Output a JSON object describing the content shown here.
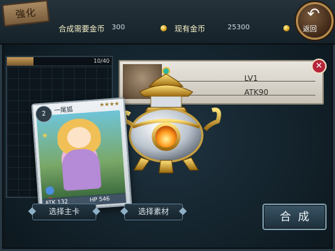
{
  "header": {
    "title": "強化",
    "cost_label": "合成需要金币",
    "cost_value": "300",
    "gold_label": "现有金币",
    "gold_value": "25300",
    "back_label": "返回"
  },
  "left_panel": {
    "progress_text": "10/40",
    "progress_fraction": 0.25
  },
  "card": {
    "level": "2",
    "name": "一尾狐",
    "atk": "ATK 132",
    "hp": "HP 546"
  },
  "info_panel": {
    "lv": "LV1",
    "atk": "ATK90"
  },
  "buttons": {
    "select_main": "选择主卡",
    "select_material": "选择素材",
    "combine": "合成"
  },
  "colors": {
    "gold": "#d9a21b",
    "close_red": "#b5253a"
  }
}
